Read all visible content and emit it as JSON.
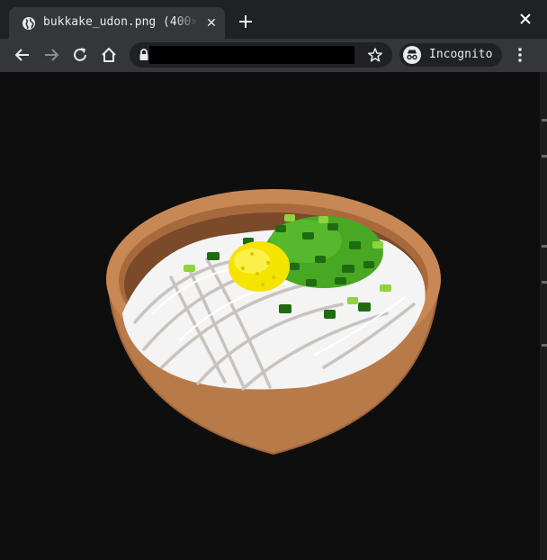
{
  "tab": {
    "title": "bukkake_udon.png (400×",
    "favicon": "globe-icon",
    "close_glyph": "✕"
  },
  "toolbar": {
    "back_icon": "arrow-left-icon",
    "forward_icon": "arrow-right-icon",
    "reload_icon": "reload-icon",
    "home_icon": "home-icon",
    "url": "",
    "bookmark_icon": "star-icon",
    "incognito_label": "Incognito",
    "menu_icon": "kebab-menu-icon"
  },
  "image": {
    "subject": "bowl of bukkake udon illustration"
  },
  "colors": {
    "tabstrip": "#202124",
    "tab_active": "#35363a",
    "toolbar": "#35363a",
    "omnibox": "#202124",
    "viewer_background": "#0e0e0e",
    "bowl": "#b97a4a",
    "noodles": "#f4f4f4",
    "green_onion": "#3f9d1f",
    "ginger": "#f5e400"
  }
}
